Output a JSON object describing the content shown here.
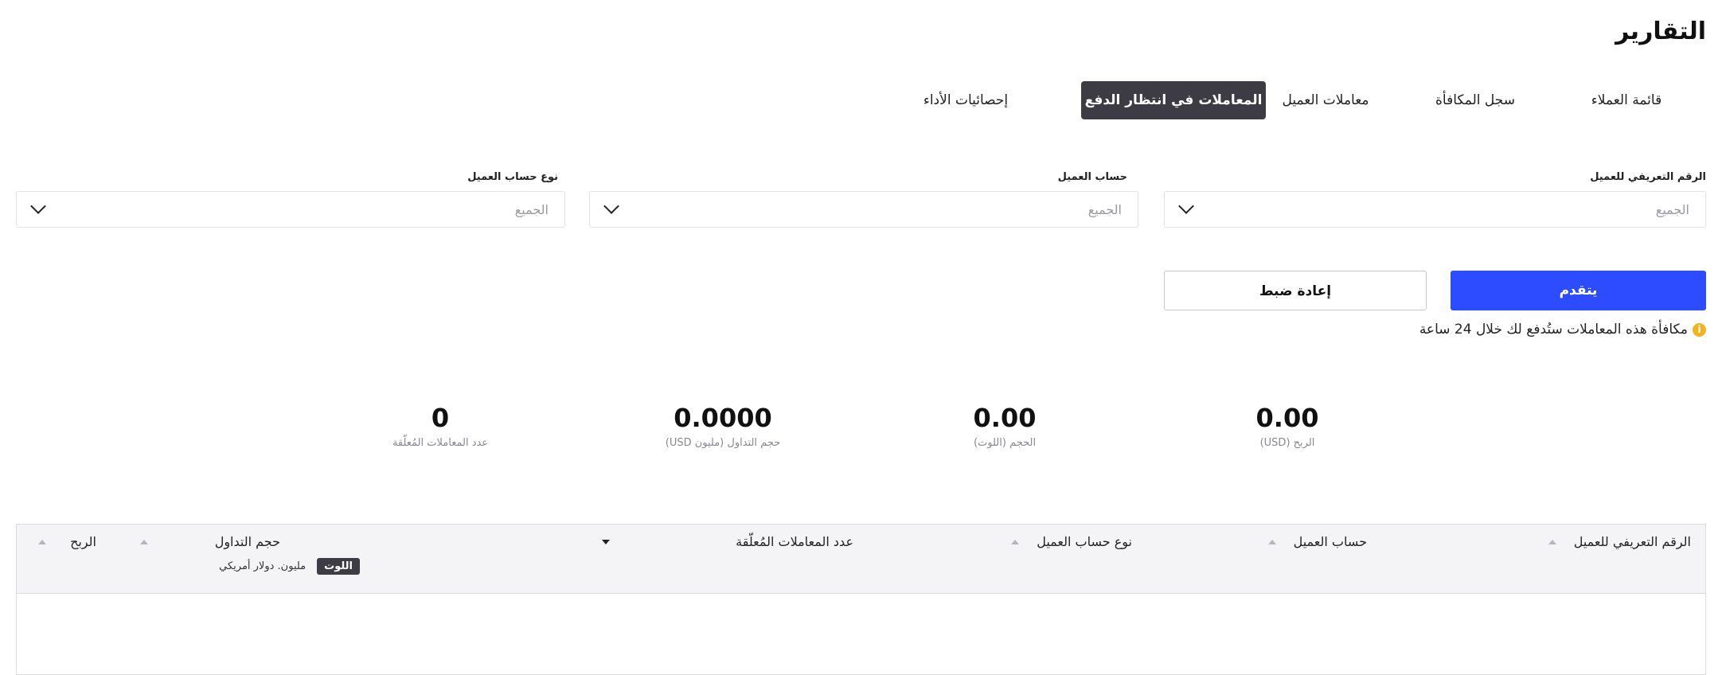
{
  "page": {
    "title": "التقارير"
  },
  "tabs": [
    {
      "label": "قائمة العملاء"
    },
    {
      "label": "سجل المكافأة"
    },
    {
      "label": "معاملات العميل"
    },
    {
      "label": "المعاملات في انتظار الدفع"
    },
    {
      "label": "إحصائيات الأداء"
    }
  ],
  "filters": {
    "client_id": {
      "label": "الرقم التعريفي للعميل",
      "value": "الجميع"
    },
    "client_account": {
      "label": "حساب العميل",
      "value": "الجميع"
    },
    "account_type": {
      "label": "نوع حساب العميل",
      "value": "الجميع"
    }
  },
  "actions": {
    "apply_label": "يتقدم",
    "reset_label": "إعادة ضبط"
  },
  "notice": {
    "text": "مكافأة هذه المعاملات ستُدفع لك خلال 24 ساعة"
  },
  "stats": [
    {
      "value": "0.00",
      "label": "الربح (USD)"
    },
    {
      "value": "0.00",
      "label": "الحجم (اللوت)"
    },
    {
      "value": "0.0000",
      "label": "حجم التداول (مليون USD)"
    },
    {
      "value": "0",
      "label": "عدد المعاملات المُعلّقة"
    }
  ],
  "table": {
    "columns": [
      {
        "label": "الرقم التعريفي للعميل"
      },
      {
        "label": "حساب العميل"
      },
      {
        "label": "نوع حساب العميل"
      },
      {
        "label": "عدد المعاملات المُعلّقة"
      },
      {
        "label": "حجم التداول",
        "sub_tag": "اللوت",
        "sub_text": "مليون. دولار أمريكي"
      },
      {
        "label": "الربح"
      }
    ]
  },
  "colors": {
    "primary": "#2d4bff",
    "active_tab": "#3d3c44",
    "info": "#f0b323"
  }
}
